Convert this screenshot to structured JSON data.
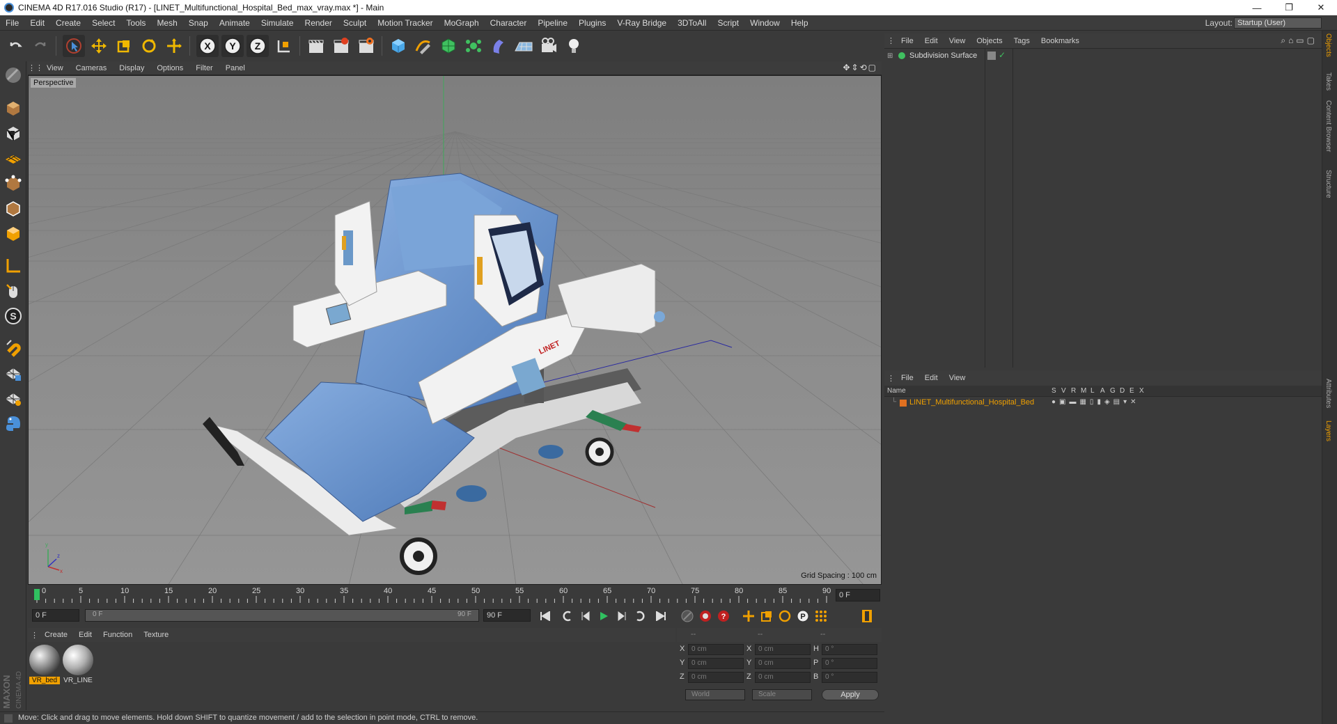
{
  "window": {
    "title": "CINEMA 4D R17.016 Studio (R17) - [LINET_Multifunctional_Hospital_Bed_max_vray.max *] - Main",
    "minimize": "—",
    "maximize": "❐",
    "close": "✕"
  },
  "menubar": {
    "items": [
      "File",
      "Edit",
      "Create",
      "Select",
      "Tools",
      "Mesh",
      "Snap",
      "Animate",
      "Simulate",
      "Render",
      "Sculpt",
      "Motion Tracker",
      "MoGraph",
      "Character",
      "Pipeline",
      "Plugins",
      "V-Ray Bridge",
      "3DToAll",
      "Script",
      "Window",
      "Help"
    ],
    "layout_label": "Layout:",
    "layout_value": "Startup (User)"
  },
  "viewport": {
    "menu": [
      "View",
      "Cameras",
      "Display",
      "Options",
      "Filter",
      "Panel"
    ],
    "label": "Perspective",
    "grid_spacing": "Grid Spacing : 100 cm",
    "model_brand": "LINET"
  },
  "timeline": {
    "ticks": [
      "0",
      "5",
      "10",
      "15",
      "20",
      "25",
      "30",
      "35",
      "40",
      "45",
      "50",
      "55",
      "60",
      "65",
      "70",
      "75",
      "80",
      "85",
      "90"
    ],
    "current_frame": "0 F",
    "start": "0 F",
    "range_start": "0 F",
    "range_end": "90 F",
    "end": "90 F"
  },
  "materials": {
    "menu": [
      "Create",
      "Edit",
      "Function",
      "Texture"
    ],
    "items": [
      {
        "name": "VR_bed",
        "selected": true
      },
      {
        "name": "VR_LINE",
        "selected": false
      }
    ]
  },
  "coords": {
    "head": [
      "--",
      "--",
      "--"
    ],
    "rows": [
      {
        "a": "X",
        "av": "0 cm",
        "b": "X",
        "bv": "0 cm",
        "c": "H",
        "cv": "0 °"
      },
      {
        "a": "Y",
        "av": "0 cm",
        "b": "Y",
        "bv": "0 cm",
        "c": "P",
        "cv": "0 °"
      },
      {
        "a": "Z",
        "av": "0 cm",
        "b": "Z",
        "bv": "0 cm",
        "c": "B",
        "cv": "0 °"
      }
    ],
    "world": "World",
    "scale": "Scale",
    "apply": "Apply"
  },
  "objects": {
    "menu": [
      "File",
      "Edit",
      "View",
      "Objects",
      "Tags",
      "Bookmarks"
    ],
    "items": [
      {
        "name": "Subdivision Surface"
      }
    ]
  },
  "layers": {
    "menu": [
      "File",
      "Edit",
      "View"
    ],
    "name_col": "Name",
    "flags": [
      "S",
      "V",
      "R",
      "M",
      "L",
      "A",
      "G",
      "D",
      "E",
      "X"
    ],
    "items": [
      {
        "name": "LINET_Multifunctional_Hospital_Bed",
        "color": "#e07020"
      }
    ]
  },
  "side_tabs": [
    "Objects",
    "Takes",
    "Content Browser",
    "Structure",
    "Attributes",
    "Layers"
  ],
  "status": "Move: Click and drag to move elements. Hold down SHIFT to quantize movement / add to the selection in point mode, CTRL to remove.",
  "logo": {
    "line1": "MAXON",
    "line2": "CINEMA 4D"
  },
  "colors": {
    "accent": "#f0a000",
    "selection_blue": "#4a90d9"
  }
}
